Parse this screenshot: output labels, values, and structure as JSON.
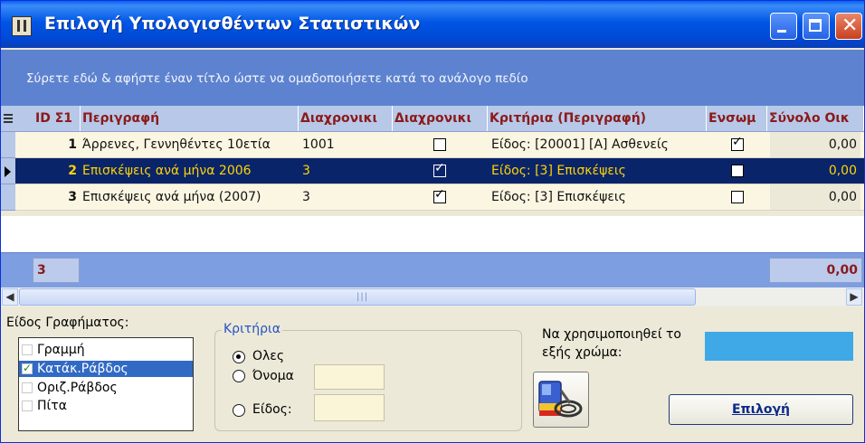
{
  "window": {
    "title": "Επιλογή Υπολογισθέντων Στατιστικών"
  },
  "group_panel": {
    "hint": "Σύρετε εδώ & αφήστε έναν τίτλο ώστε να ομαδοποιήσετε κατά το ανάλογο πεδίο"
  },
  "grid": {
    "columns": [
      "ID Σ1",
      "Περιγραφή",
      "Διαχρονικι",
      "Διαχρονικι",
      "Κριτήρια (Περιγραφή)",
      "Ενσωμ",
      "Σύνολο Οικ"
    ],
    "rows": [
      {
        "id": "1",
        "desc": "Άρρενες, Γεννηθέντες 10ετία",
        "diax1": "1001",
        "diax2": false,
        "crit": "Είδος: [20001] [Α] Ασθενείς",
        "ensom": true,
        "total": "0,00"
      },
      {
        "id": "2",
        "desc": "Επισκέψεις ανά μήνα 2006",
        "diax1": "3",
        "diax2": true,
        "crit": "Είδος: [3] Επισκέψεις",
        "ensom": false,
        "total": "0,00"
      },
      {
        "id": "3",
        "desc": "Επισκέψεις ανά μήνα (2007)",
        "diax1": "3",
        "diax2": true,
        "crit": "Είδος: [3] Επισκέψεις",
        "ensom": false,
        "total": "0,00"
      }
    ],
    "selected_row": 2,
    "footer": {
      "count": "3",
      "total": "0,00"
    }
  },
  "chart_type": {
    "label": "Είδος Γραφήματος:",
    "options": [
      {
        "label": "Γραμμή",
        "checked": false
      },
      {
        "label": "Κατάκ.Ράβδος",
        "checked": true
      },
      {
        "label": "Οριζ.Ράβδος",
        "checked": false
      },
      {
        "label": "Πίτα",
        "checked": false
      }
    ]
  },
  "criteria": {
    "title": "Κριτήρια",
    "all_label": "Ολες",
    "name_label": "Όνομα",
    "type_label": "Είδος:",
    "selected": "Ολες"
  },
  "color": {
    "label_line1": "Να χρησιμοποιηθεί το",
    "label_line2": "εξής χρώμα:",
    "value": "#3ea9e6"
  },
  "buttons": {
    "select_label": "Επιλογή"
  },
  "icons": {
    "table": "table-icon",
    "palette": "paint-palette-icon"
  }
}
